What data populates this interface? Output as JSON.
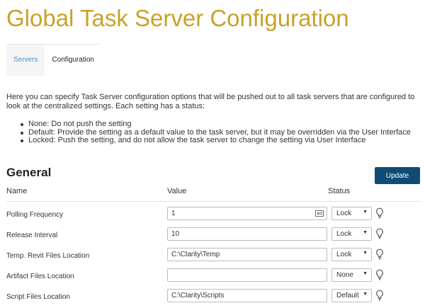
{
  "page": {
    "title": "Global Task Server Configuration"
  },
  "tabs": [
    {
      "label": "Servers"
    },
    {
      "label": "Configuration"
    }
  ],
  "intro": {
    "text": "Here you can specify Task Server configuration options that will be pushed out to all task servers that are configured to look at the centralized settings. Each setting has a status:",
    "bullets": [
      "None: Do not push the setting",
      "Default: Provide the setting as a default value to the task server, but it may be overridden via the User Interface",
      "Locked: Push the setting, and do not allow the task server to change the setting via User Interface"
    ]
  },
  "general": {
    "title": "General",
    "update_label": "Update",
    "columns": {
      "name": "Name",
      "value": "Value",
      "status": "Status"
    },
    "rows": [
      {
        "name": "Polling Frequency",
        "value": "1",
        "status": "Lock"
      },
      {
        "name": "Release Interval",
        "value": "10",
        "status": "Lock"
      },
      {
        "name": "Temp. Revit Files Location",
        "value": "C:\\Clarity\\Temp",
        "status": "Lock"
      },
      {
        "name": "Artifact Files Location",
        "value": "",
        "status": "None"
      },
      {
        "name": "Script Files Location",
        "value": "C:\\Clarity\\Scripts",
        "status": "Default"
      }
    ]
  },
  "colors": {
    "title": "#c9a227",
    "active_tab_text": "#4a90c9",
    "update_button": "#0f4c75"
  },
  "icons": {
    "status_hint": "lightbulb-icon",
    "number_field": "number-keypad-icon",
    "dropdown": "caret-down-icon"
  }
}
